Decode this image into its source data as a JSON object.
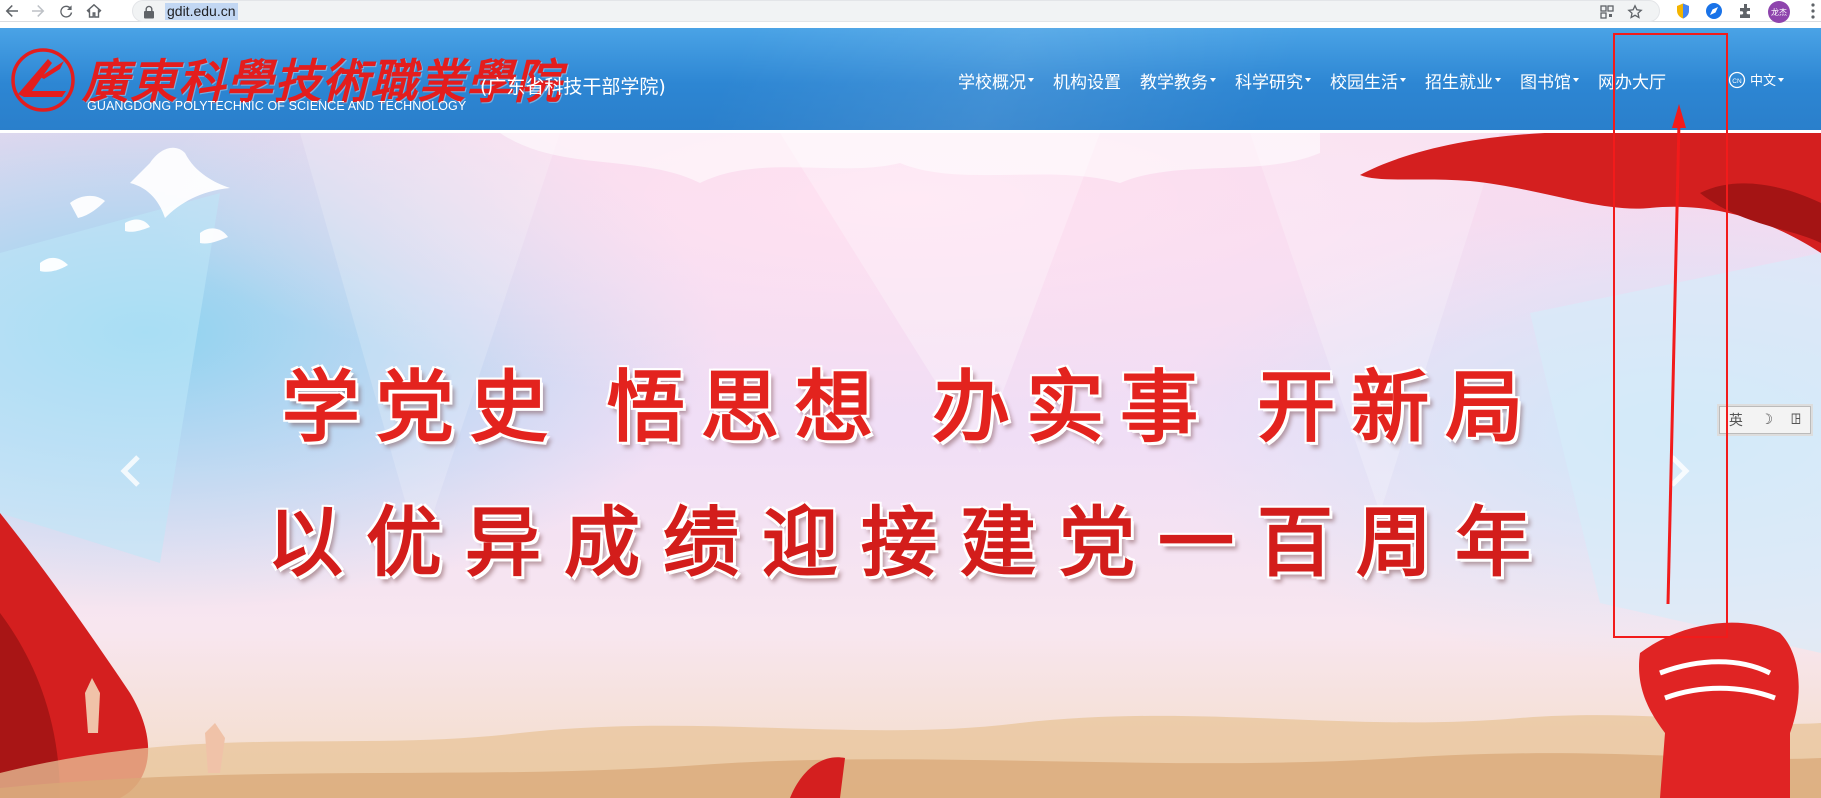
{
  "browser": {
    "url": "gdit.edu.cn",
    "profile_initials": "龙杰",
    "icons": [
      "back-icon",
      "forward-icon",
      "reload-icon",
      "home-icon",
      "lock-icon",
      "qr-code-icon",
      "bookmark-star-icon",
      "extension-icon",
      "menu-icon"
    ]
  },
  "header": {
    "logo_cn": "廣東科學技術職業學院",
    "logo_en": "GUANGDONG POLYTECHNIC OF SCIENCE AND TECHNOLOGY",
    "subtitle": "(广东省科技干部学院)",
    "nav": [
      {
        "label": "学校概况",
        "has_dropdown": true
      },
      {
        "label": "机构设置",
        "has_dropdown": false
      },
      {
        "label": "教学教务",
        "has_dropdown": true
      },
      {
        "label": "科学研究",
        "has_dropdown": true
      },
      {
        "label": "校园生活",
        "has_dropdown": true
      },
      {
        "label": "招生就业",
        "has_dropdown": true
      },
      {
        "label": "图书馆",
        "has_dropdown": true
      },
      {
        "label": "网办大厅",
        "has_dropdown": false
      }
    ],
    "language": "中文",
    "language_badge": "CN"
  },
  "banner": {
    "slogan_line1": "学党史 悟思想 办实事 开新局",
    "slogan_line2": "以优异成绩迎接建党一百周年",
    "ime_labels": [
      "英",
      "☽",
      "ꖸ"
    ]
  },
  "colors": {
    "header_blue": "#2d86d3",
    "logo_red": "#e41d1d",
    "slogan_red": "#e3231e",
    "annotation_red": "#f21b1b"
  }
}
